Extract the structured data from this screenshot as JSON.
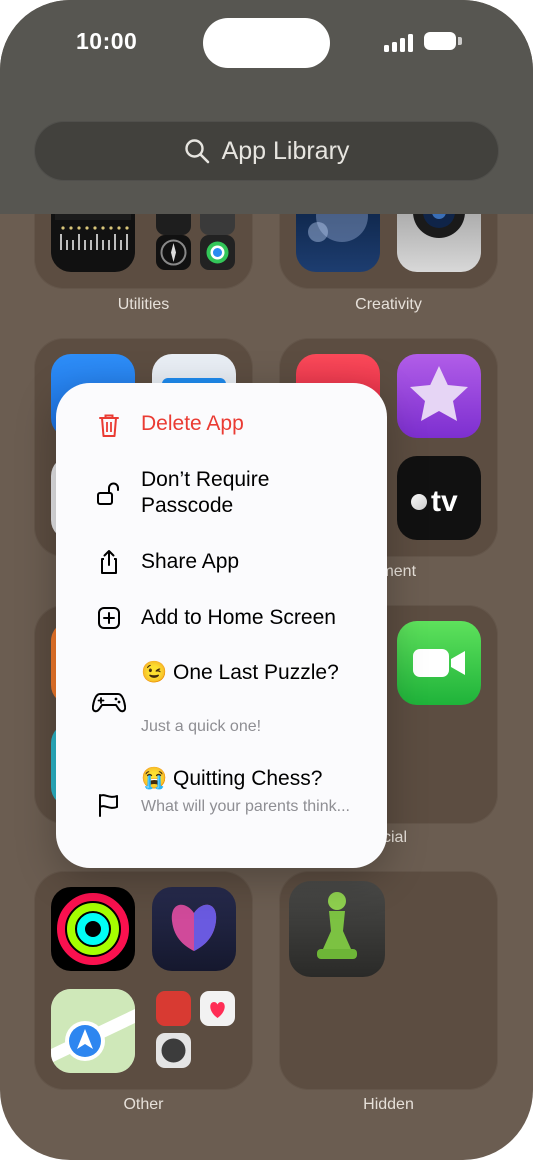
{
  "status_bar": {
    "time": "10:00"
  },
  "search": {
    "placeholder": "App Library"
  },
  "folders": {
    "utilities": "Utilities",
    "creativity": "Creativity",
    "entertainment_partial": "inment",
    "social_partial": "cial",
    "other": "Other",
    "hidden": "Hidden"
  },
  "apps": {
    "appletv_label": "tv"
  },
  "context_menu": {
    "delete": "Delete App",
    "passcode": "Don’t Require Passcode",
    "share": "Share App",
    "add_home": "Add to Home Screen",
    "puzzle_title": "😉 One Last Puzzle?",
    "puzzle_subtitle": "Just a quick one!",
    "chess_title": "😭 Quitting Chess?",
    "chess_subtitle": "What will your parents think..."
  },
  "colors": {
    "delete_red": "#ea3b33",
    "wallpaper": "#6b5d51",
    "top_band": "#575651"
  },
  "icons": [
    "search-icon",
    "trash-icon",
    "unlock-icon",
    "share-icon",
    "plus-square-icon",
    "gamepad-icon",
    "flag-icon"
  ]
}
